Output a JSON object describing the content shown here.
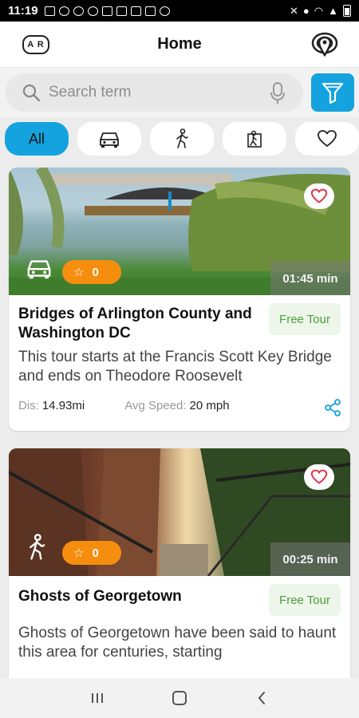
{
  "status_bar": {
    "time": "11:19"
  },
  "header": {
    "title": "Home",
    "ar_label": "A R"
  },
  "search": {
    "placeholder": "Search term"
  },
  "chips": {
    "all_label": "All"
  },
  "tours": [
    {
      "title": "Bridges of Arlington County and Washington DC",
      "price_tag": "Free Tour",
      "description": "This tour starts at the Francis Scott Key Bridge and ends on Theodore Roosevelt",
      "rating": "0",
      "duration": "01:45 min",
      "distance_label": "Dis:",
      "distance": "14.93mi",
      "speed_label": "Avg Speed:",
      "speed": "20 mph",
      "mode_icon": "car-icon"
    },
    {
      "title": "Ghosts of Georgetown",
      "price_tag": "Free Tour",
      "description": "Ghosts of Georgetown have been said to haunt this area for centuries, starting",
      "rating": "0",
      "duration": "00:25 min",
      "mode_icon": "walk-icon"
    }
  ],
  "colors": {
    "accent": "#14a3de",
    "badge": "#f58e0f",
    "free_tag": "#4aa13b",
    "heart": "#e0364a"
  }
}
